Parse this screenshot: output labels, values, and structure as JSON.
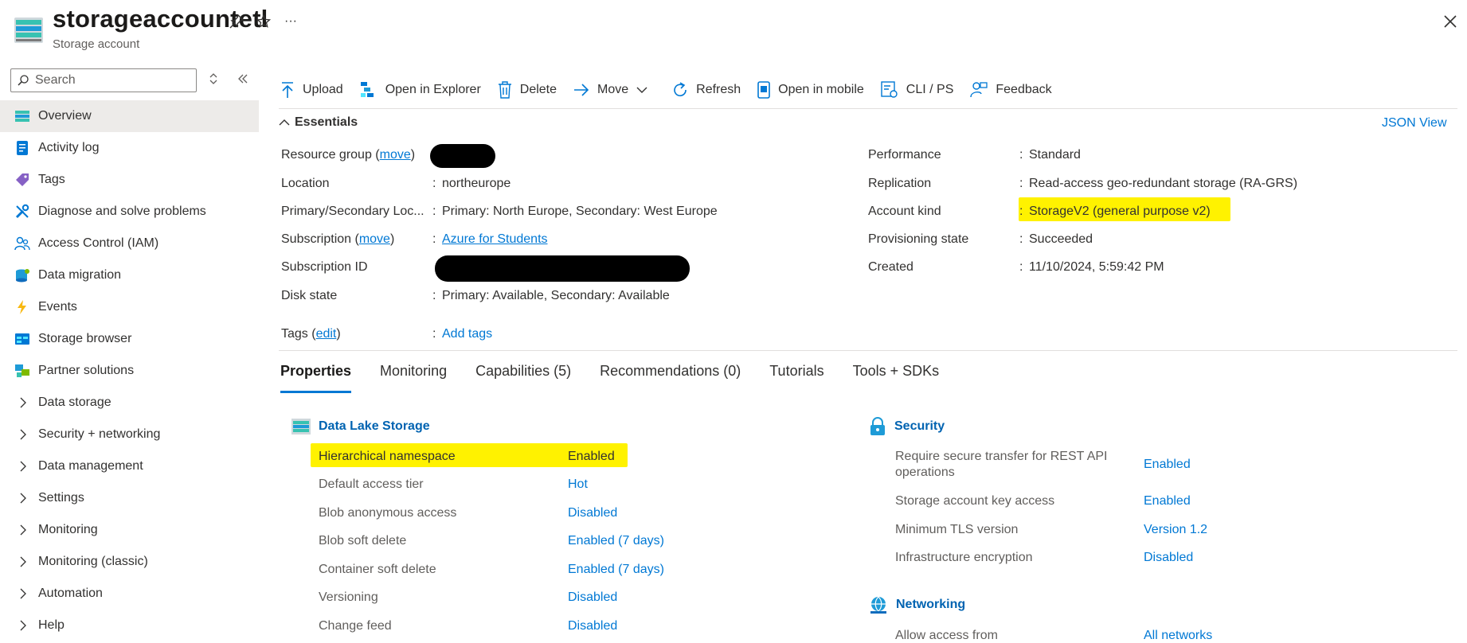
{
  "header": {
    "title": "storageaccountetl",
    "subtitle": "Storage account",
    "pin_icon": "pin-icon",
    "favorite_icon": "star-icon",
    "more_label": "···",
    "close_icon": "close-icon"
  },
  "sidebar": {
    "search_placeholder": "Search",
    "items": [
      {
        "label": "Overview",
        "icon": "overview-icon",
        "active": true
      },
      {
        "label": "Activity log",
        "icon": "activity-log-icon"
      },
      {
        "label": "Tags",
        "icon": "tag-icon"
      },
      {
        "label": "Diagnose and solve problems",
        "icon": "wrench-icon"
      },
      {
        "label": "Access Control (IAM)",
        "icon": "people-icon"
      },
      {
        "label": "Data migration",
        "icon": "migration-icon"
      },
      {
        "label": "Events",
        "icon": "lightning-icon"
      },
      {
        "label": "Storage browser",
        "icon": "storage-browser-icon"
      },
      {
        "label": "Partner solutions",
        "icon": "partner-icon"
      },
      {
        "label": "Data storage",
        "icon": "chevron-right-icon"
      },
      {
        "label": "Security + networking",
        "icon": "chevron-right-icon"
      },
      {
        "label": "Data management",
        "icon": "chevron-right-icon"
      },
      {
        "label": "Settings",
        "icon": "chevron-right-icon"
      },
      {
        "label": "Monitoring",
        "icon": "chevron-right-icon"
      },
      {
        "label": "Monitoring (classic)",
        "icon": "chevron-right-icon"
      },
      {
        "label": "Automation",
        "icon": "chevron-right-icon"
      },
      {
        "label": "Help",
        "icon": "chevron-right-icon"
      }
    ]
  },
  "toolbar": {
    "upload": "Upload",
    "open_in_explorer": "Open in Explorer",
    "delete": "Delete",
    "move": "Move",
    "refresh": "Refresh",
    "open_in_mobile": "Open in mobile",
    "cli_ps": "CLI / PS",
    "feedback": "Feedback"
  },
  "essentials": {
    "title": "Essentials",
    "json_view": "JSON View",
    "left": {
      "resource_group_label": "Resource group",
      "move_link": "move",
      "location_label": "Location",
      "location_value": "northeurope",
      "primary_secondary_label": "Primary/Secondary Loc...",
      "primary_secondary_value": "Primary: North Europe, Secondary: West Europe",
      "subscription_label": "Subscription",
      "subscription_value": "Azure for Students",
      "subscription_id_label": "Subscription ID",
      "disk_state_label": "Disk state",
      "disk_state_value": "Primary: Available, Secondary: Available",
      "tags_label": "Tags",
      "edit_link": "edit",
      "add_tags": "Add tags"
    },
    "right": {
      "performance_label": "Performance",
      "performance_value": "Standard",
      "replication_label": "Replication",
      "replication_value": "Read-access geo-redundant storage (RA-GRS)",
      "account_kind_label": "Account kind",
      "account_kind_value": "StorageV2 (general purpose v2)",
      "provisioning_label": "Provisioning state",
      "provisioning_value": "Succeeded",
      "created_label": "Created",
      "created_value": "11/10/2024, 5:59:42 PM"
    },
    "colon": ":"
  },
  "tabs": [
    "Properties",
    "Monitoring",
    "Capabilities (5)",
    "Recommendations (0)",
    "Tutorials",
    "Tools + SDKs"
  ],
  "data_lake": {
    "title": "Data Lake Storage",
    "rows": [
      {
        "label": "Hierarchical namespace",
        "value": "Enabled"
      },
      {
        "label": "Default access tier",
        "value": "Hot"
      },
      {
        "label": "Blob anonymous access",
        "value": "Disabled"
      },
      {
        "label": "Blob soft delete",
        "value": "Enabled (7 days)"
      },
      {
        "label": "Container soft delete",
        "value": "Enabled (7 days)"
      },
      {
        "label": "Versioning",
        "value": "Disabled"
      },
      {
        "label": "Change feed",
        "value": "Disabled"
      }
    ]
  },
  "security": {
    "title": "Security",
    "rows": [
      {
        "label_line1": "Require secure transfer for REST API",
        "label_line2": "operations",
        "value": "Enabled"
      },
      {
        "label": "Storage account key access",
        "value": "Enabled"
      },
      {
        "label": "Minimum TLS version",
        "value": "Version 1.2"
      },
      {
        "label": "Infrastructure encryption",
        "value": "Disabled"
      }
    ]
  },
  "networking": {
    "title": "Networking",
    "rows": [
      {
        "label": "Allow access from",
        "value": "All networks"
      }
    ]
  },
  "colors": {
    "accent": "#0078d4",
    "highlight": "#fff200",
    "text": "#323130"
  }
}
